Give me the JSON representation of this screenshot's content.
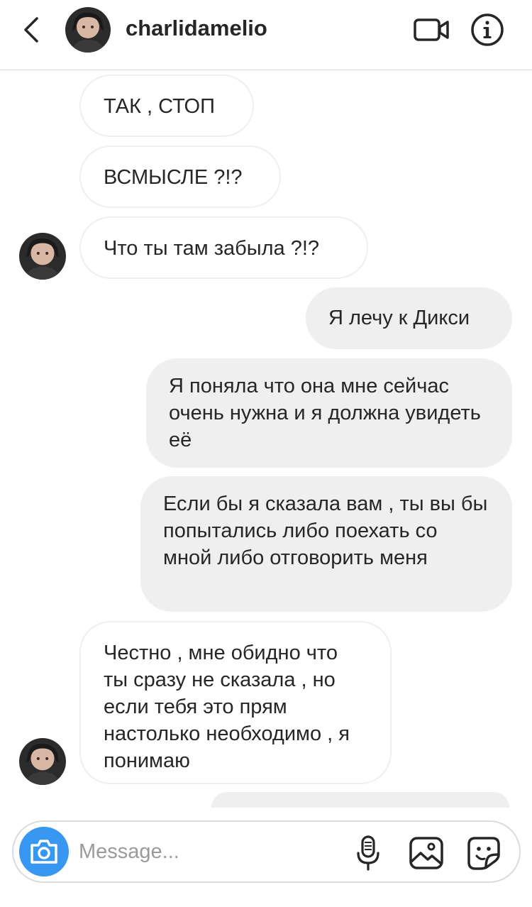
{
  "header": {
    "username": "charlidamelio",
    "back_icon": "chevron-left-icon",
    "video_icon": "video-camera-icon",
    "info_icon": "info-icon"
  },
  "messages": [
    {
      "direction": "incoming",
      "text": "ТАК , СТОП"
    },
    {
      "direction": "incoming",
      "text": "ВСМЫСЛЕ ?!?"
    },
    {
      "direction": "incoming",
      "text": "Что ты там забыла ?!?"
    },
    {
      "direction": "outgoing",
      "text": "Я лечу к Дикси"
    },
    {
      "direction": "outgoing",
      "text": "Я поняла что она мне сейчас очень нужна и я должна увидеть её"
    },
    {
      "direction": "outgoing",
      "text": "Если бы я сказала вам , ты вы бы попытались либо поехать со мной либо отговорить меня"
    },
    {
      "direction": "incoming",
      "text": "Честно , мне обидно что ты сразу не сказала , но если тебя это прям настолько необходимо , я понимаю"
    }
  ],
  "composer": {
    "placeholder": "Message...",
    "camera_icon": "camera-icon",
    "mic_icon": "microphone-icon",
    "gallery_icon": "gallery-icon",
    "sticker_icon": "sticker-icon"
  },
  "colors": {
    "accent": "#3897f0",
    "outgoing_bubble": "#efefef",
    "incoming_border": "#efefef",
    "text": "#262626"
  }
}
